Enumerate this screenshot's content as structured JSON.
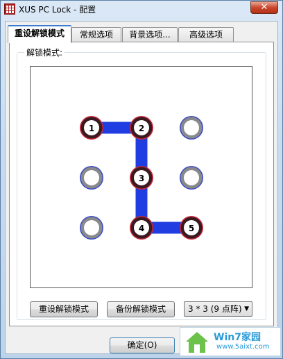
{
  "window": {
    "title": "XUS PC Lock - 配置",
    "close_symbol": "✕"
  },
  "tabs": [
    {
      "label": "重设解锁模式",
      "active": true
    },
    {
      "label": "常规选项",
      "active": false
    },
    {
      "label": "背景选项...",
      "active": false
    },
    {
      "label": "高级选项",
      "active": false
    }
  ],
  "group": {
    "label": "解锁模式:"
  },
  "pattern": {
    "grid": "3x3",
    "sequence": [
      1,
      2,
      3,
      4,
      5
    ],
    "nodes": [
      {
        "label": "1",
        "selected": true
      },
      {
        "label": "2",
        "selected": true
      },
      {
        "label": "",
        "selected": false
      },
      {
        "label": "",
        "selected": false
      },
      {
        "label": "3",
        "selected": true
      },
      {
        "label": "",
        "selected": false
      },
      {
        "label": "",
        "selected": false
      },
      {
        "label": "4",
        "selected": true
      },
      {
        "label": "5",
        "selected": true
      }
    ],
    "colors": {
      "path": "#1f3de0",
      "selected_ring": "#c8283a",
      "unselected_ring": "#8a8a8a",
      "outer": "#3a4cc8"
    }
  },
  "buttons": {
    "reset_label": "重设解锁模式",
    "backup_label": "备份解锁模式",
    "ok_label": "确定(O)"
  },
  "grid_select": {
    "value": "3 * 3 (9 点阵)"
  },
  "watermark": {
    "title": "Win7家园",
    "url": "www.5aixt.com"
  }
}
